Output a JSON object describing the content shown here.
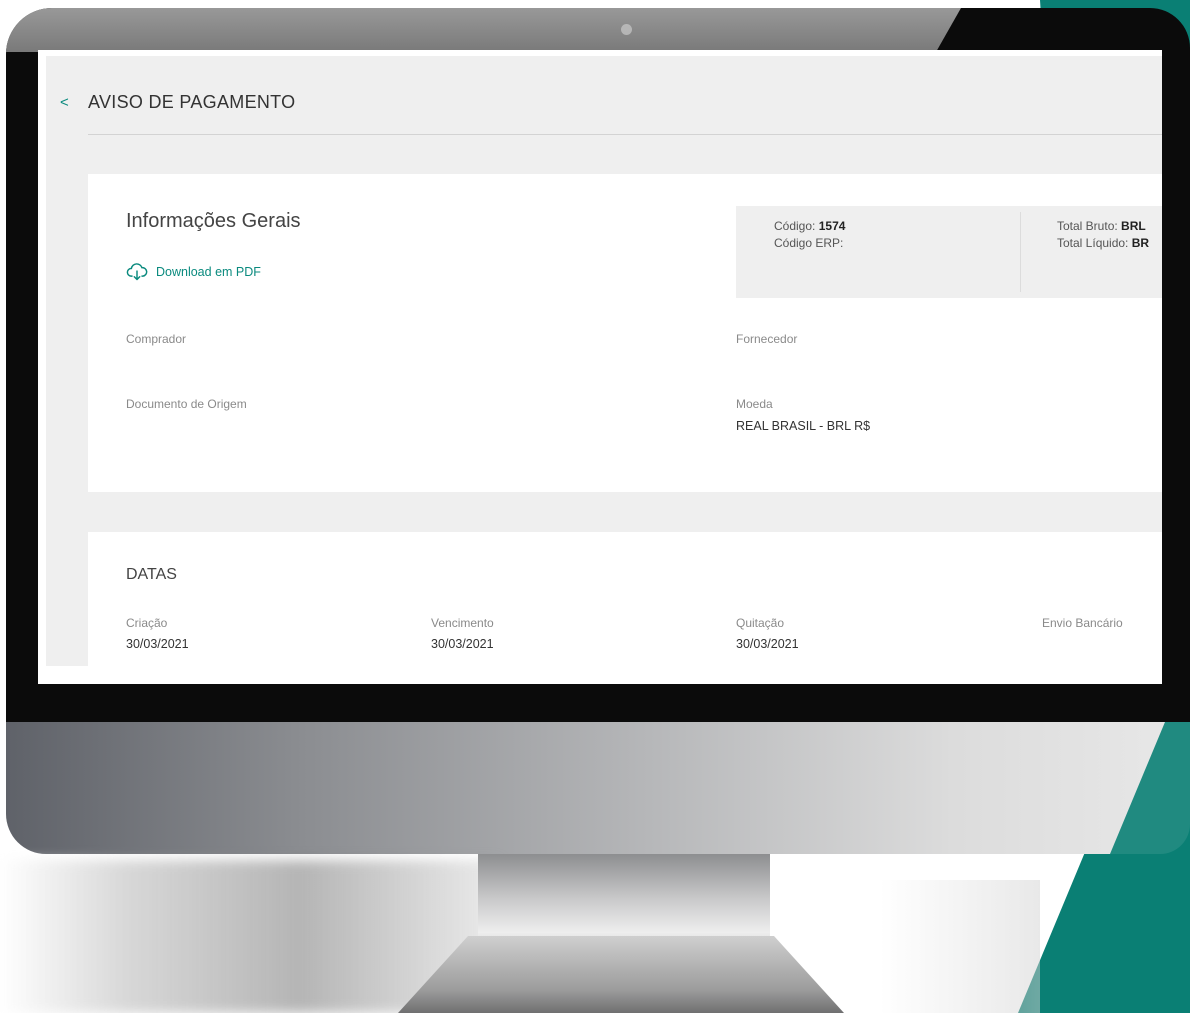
{
  "page": {
    "back_symbol": "<",
    "title": "AVISO DE PAGAMENTO"
  },
  "general_info": {
    "title": "Informações Gerais",
    "download_pdf_label": "Download em PDF",
    "summary": {
      "codigo_label": "Código:",
      "codigo_value": "1574",
      "codigo_erp_label": "Código ERP:",
      "codigo_erp_value": "",
      "total_bruto_label": "Total Bruto:",
      "total_bruto_value": "BRL",
      "total_liquido_label": "Total Líquido:",
      "total_liquido_value": "BR"
    },
    "fields": {
      "comprador_label": "Comprador",
      "comprador_value": "",
      "fornecedor_label": "Fornecedor",
      "fornecedor_value": "",
      "documento_origem_label": "Documento de Origem",
      "documento_origem_value": "",
      "moeda_label": "Moeda",
      "moeda_value": "REAL BRASIL - BRL R$"
    }
  },
  "dates": {
    "title": "DATAS",
    "items": [
      {
        "label": "Criação",
        "value": "30/03/2021"
      },
      {
        "label": "Vencimento",
        "value": "30/03/2021"
      },
      {
        "label": "Quitação",
        "value": "30/03/2021"
      },
      {
        "label": "Envio Bancário",
        "value": ""
      }
    ]
  },
  "colors": {
    "accent": "#0a8a7e",
    "brand_teal": "#0a7f74",
    "page_background": "#efefef"
  },
  "icons": {
    "back": "chevron-left-icon",
    "download": "cloud-download-icon"
  }
}
